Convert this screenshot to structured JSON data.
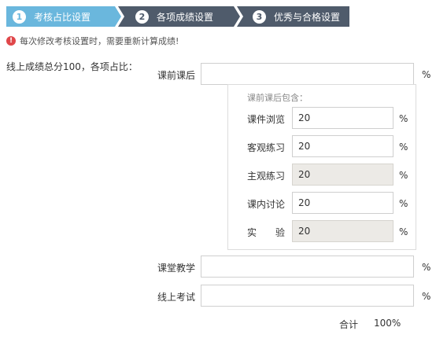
{
  "steps": [
    {
      "num": "1",
      "label": "考核占比设置"
    },
    {
      "num": "2",
      "label": "各项成绩设置"
    },
    {
      "num": "3",
      "label": "优秀与合格设置"
    }
  ],
  "notice": {
    "icon": "warning-icon",
    "text": "每次修改考核设置时，需要重新计算成绩!"
  },
  "total_label": "线上成绩总分100，各项占比：",
  "items": {
    "pre_post": {
      "label": "课前课后",
      "value": "",
      "unit": "%"
    },
    "classroom": {
      "label": "课堂教学",
      "value": "",
      "unit": "%"
    },
    "online_exam": {
      "label": "线上考试",
      "value": "",
      "unit": "%"
    }
  },
  "sub": {
    "title": "课前课后包含：",
    "items": [
      {
        "label": "课件浏览",
        "value": "20",
        "unit": "%"
      },
      {
        "label": "客观练习",
        "value": "20",
        "unit": "%"
      },
      {
        "label": "主观练习",
        "value": "20",
        "unit": "%"
      },
      {
        "label": "课内讨论",
        "value": "20",
        "unit": "%"
      },
      {
        "label": "实　　验",
        "value": "20",
        "unit": "%"
      }
    ]
  },
  "summary": {
    "label": "合计",
    "value": "100%"
  }
}
